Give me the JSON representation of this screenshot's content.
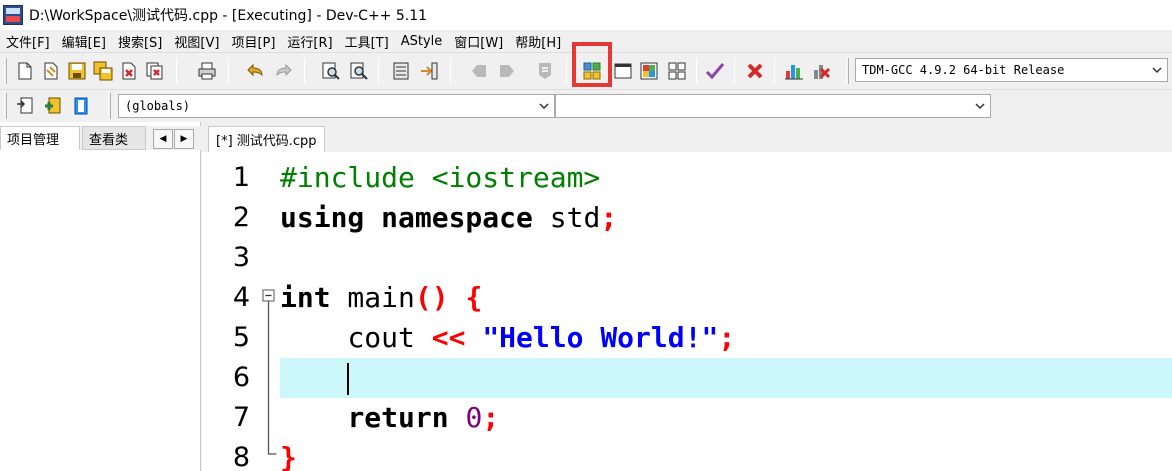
{
  "window": {
    "title": "D:\\WorkSpace\\测试代码.cpp - [Executing] - Dev-C++ 5.11"
  },
  "menu": [
    "文件[F]",
    "编辑[E]",
    "搜索[S]",
    "视图[V]",
    "项目[P]",
    "运行[R]",
    "工具[T]",
    "AStyle",
    "窗口[W]",
    "帮助[H]"
  ],
  "toolbar": {
    "compiler_select": "TDM-GCC 4.9.2 64-bit Release",
    "scope_select": "(globals)",
    "member_select": ""
  },
  "left_panel": {
    "tabs": [
      "项目管理",
      "查看类"
    ]
  },
  "editor": {
    "tab_label": "[*] 测试代码.cpp",
    "current_line": 6,
    "line_numbers": [
      "1",
      "2",
      "3",
      "4",
      "5",
      "6",
      "7",
      "8"
    ],
    "code": {
      "l1": "#include <iostream>",
      "l2_kw": "using namespace",
      "l2_id": " std",
      "l2_sym": ";",
      "l4_kw": "int",
      "l4_id": " main",
      "l4_sym1": "()",
      "l4_sym2": "{",
      "l5_id": "cout",
      "l5_sym1": "<<",
      "l5_str": "\"Hello World!\"",
      "l5_sym2": ";",
      "l7_kw": "return",
      "l7_num": "0",
      "l7_sym": ";",
      "l8_sym": "}"
    }
  },
  "colors": {
    "highlight_box": "#e53935",
    "current_line_bg": "#ccf8fb",
    "preprocessor": "#008000",
    "string": "#0000ff",
    "symbol": "#ff0000",
    "number": "#800080"
  }
}
